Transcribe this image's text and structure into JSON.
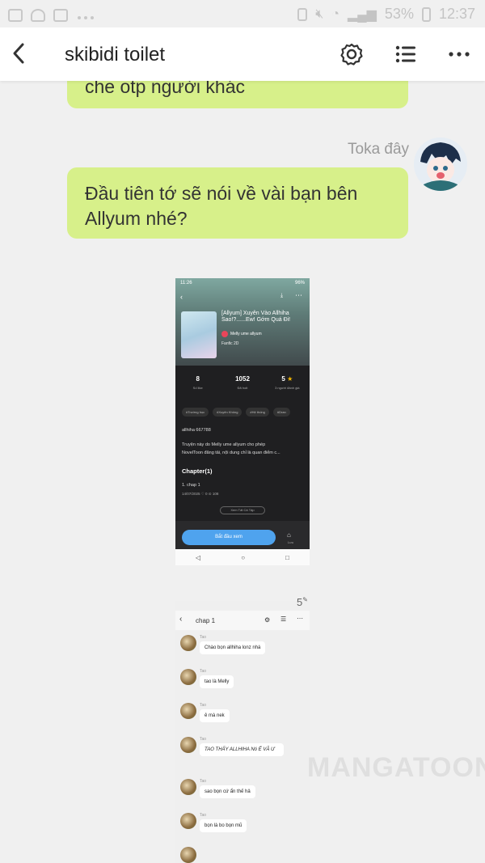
{
  "status_bar": {
    "battery": "53%",
    "time": "12:37"
  },
  "header": {
    "title": "skibidi toilet"
  },
  "messages": [
    {
      "text": "che otp người khác"
    },
    {
      "sender": "Toka đây",
      "text_line1": "Đầu tiên tớ sẽ nói về vài bạn bên",
      "text_line2": "Allyum nhé?"
    }
  ],
  "screenshot1": {
    "status_time": "11:26",
    "status_right": "96%",
    "story_title": "[Allyum] Xuyên Vào Allhiha Sao!?......Ew! Gớm Quá Đi!",
    "author": "Melly ume allyum",
    "genre": "Fanfic 2D",
    "stats": [
      {
        "value": "8",
        "label": "Số like"
      },
      {
        "value": "1052",
        "label": "Đã hoit"
      },
      {
        "value": "5",
        "label": "3 người đánh giá"
      }
    ],
    "tags": [
      "#Trường học",
      "#Xuyên Không",
      "#Hệ thống",
      "#Dran"
    ],
    "intro_title": "allhiha 667788",
    "desc_line1": "Truyện này do Melly ume allyum cho phép",
    "desc_line2": "NovelToon đăng tải, nội dung chỉ là quan điểm c...",
    "chapters_heading": "Chapter(1)",
    "chapter_name": "1. chap 1",
    "chapter_meta": "14/07/2025  ♡ 0  ⊙ 108",
    "see_all": "Xem Tất Cả Tập",
    "start_button": "Bắt đầu xem",
    "save_label": "Lưu"
  },
  "screenshot2": {
    "title": "chap 1",
    "messages": [
      {
        "name": "Tao",
        "text": "Chào bọn allhiha lonz nhá"
      },
      {
        "name": "Tao",
        "text": "tao là Melly"
      },
      {
        "name": "Tao",
        "text": "ê mà nek"
      },
      {
        "name": "Tao",
        "text": "TAO THẤY ALLHIHA Nó Ế VÃ Ư"
      },
      {
        "name": "Tao",
        "text": "sao bọn cứ ẩn thế hả"
      },
      {
        "name": "Tao",
        "text": "bọn là bo bọn mũ"
      }
    ]
  },
  "badge_count": "5",
  "watermark": "MANGATOON"
}
